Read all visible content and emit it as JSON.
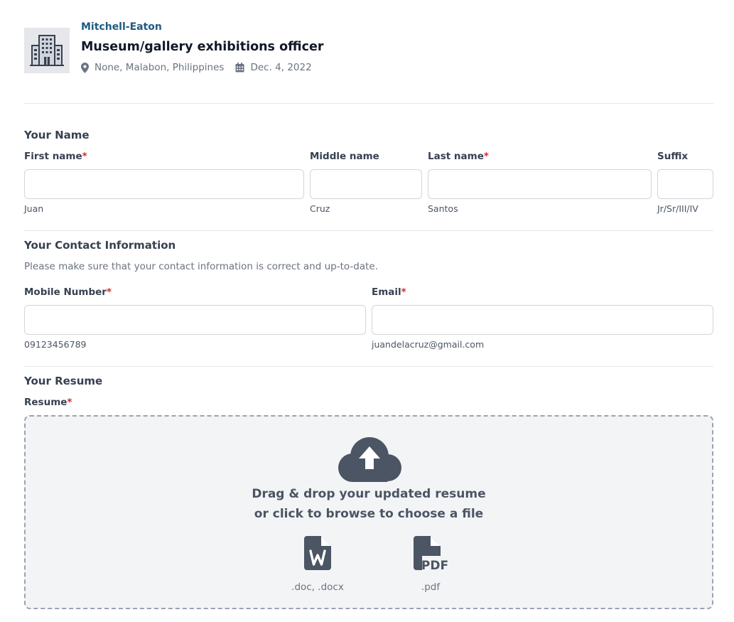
{
  "job": {
    "company": "Mitchell-Eaton",
    "title": "Museum/gallery exhibitions officer",
    "location": "None, Malabon, Philippines",
    "date": "Dec. 4, 2022"
  },
  "icons": {
    "logo": "building-icon",
    "location": "map-marker-icon",
    "date": "calendar-icon",
    "upload": "cloud-upload-icon",
    "word": "file-word-icon",
    "pdf": "file-pdf-icon"
  },
  "colors": {
    "company_link": "#1e5b83",
    "required_asterisk": "#dc2626",
    "icon_gray": "#4b5563"
  },
  "name_section": {
    "title": "Your Name",
    "first": {
      "label": "First name",
      "required": "*",
      "value": "",
      "help": "Juan"
    },
    "middle": {
      "label": "Middle name",
      "value": "",
      "help": "Cruz"
    },
    "last": {
      "label": "Last name",
      "required": "*",
      "value": "",
      "help": "Santos"
    },
    "suffix": {
      "label": "Suffix",
      "value": "",
      "help": "Jr/Sr/III/IV"
    }
  },
  "contact_section": {
    "title": "Your Contact Information",
    "description": "Please make sure that your contact information is correct and up-to-date.",
    "mobile": {
      "label": "Mobile Number",
      "required": "*",
      "value": "",
      "help": "09123456789"
    },
    "email": {
      "label": "Email",
      "required": "*",
      "value": "",
      "help": "juandelacruz@gmail.com"
    }
  },
  "resume_section": {
    "title": "Your Resume",
    "label": "Resume",
    "required": "*",
    "drop_line1": "Drag & drop your updated resume",
    "drop_line2": "or click to browse to choose a file",
    "types": [
      {
        "caption": ".doc, .docx"
      },
      {
        "caption": ".pdf"
      }
    ],
    "pdf_glyph": "PDF"
  }
}
